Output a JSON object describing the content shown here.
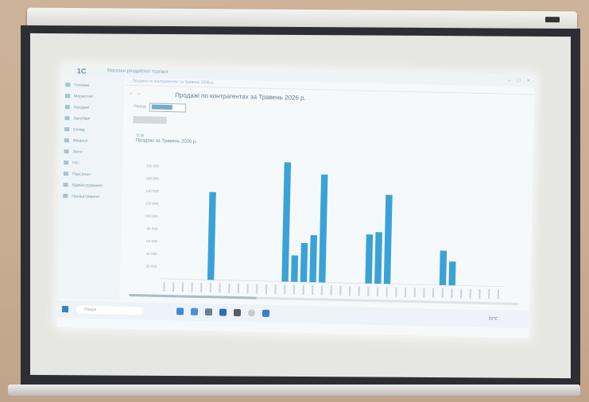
{
  "app": {
    "logo": "1С",
    "window_title": "Магазин роздрібної торгівлі",
    "sidebar": [
      {
        "label": "Головне"
      },
      {
        "label": "Маркетинг"
      },
      {
        "label": "Продажі"
      },
      {
        "label": "Закупівлі"
      },
      {
        "label": "Склад"
      },
      {
        "label": "Фінанси"
      },
      {
        "label": "Звіти"
      },
      {
        "label": "НСІ"
      },
      {
        "label": "Персонал"
      },
      {
        "label": "Адміністрування"
      },
      {
        "label": "Налаштування"
      }
    ],
    "tab_label": "Продажі по контрагентах за Травень 2026 р.",
    "document_title": "Продажі по контрагентах за Травень 2026 р.",
    "filter": {
      "label": "Період"
    },
    "report": {
      "org": "ТОВ",
      "title": "Продажі за Травень 2026 р.",
      "subtitle": ""
    },
    "taskbar": {
      "search_placeholder": "Пошук",
      "tray_temp": "21°C"
    }
  },
  "chart_data": {
    "type": "bar",
    "color": "#3aa2d6",
    "ytick_labels": [
      "20 000",
      "40 000",
      "60 000",
      "80 000",
      "100 000",
      "120 000",
      "140 000",
      "160 000",
      "180 000"
    ],
    "ylim": [
      0,
      195000
    ],
    "values": [
      0,
      0,
      0,
      0,
      0,
      140000,
      0,
      0,
      0,
      0,
      0,
      0,
      0,
      190000,
      42000,
      62000,
      75000,
      172000,
      0,
      0,
      0,
      0,
      78000,
      82000,
      142000,
      0,
      0,
      0,
      0,
      0,
      55000,
      38000,
      0,
      0,
      0,
      0,
      0
    ],
    "xtick_labels": []
  }
}
